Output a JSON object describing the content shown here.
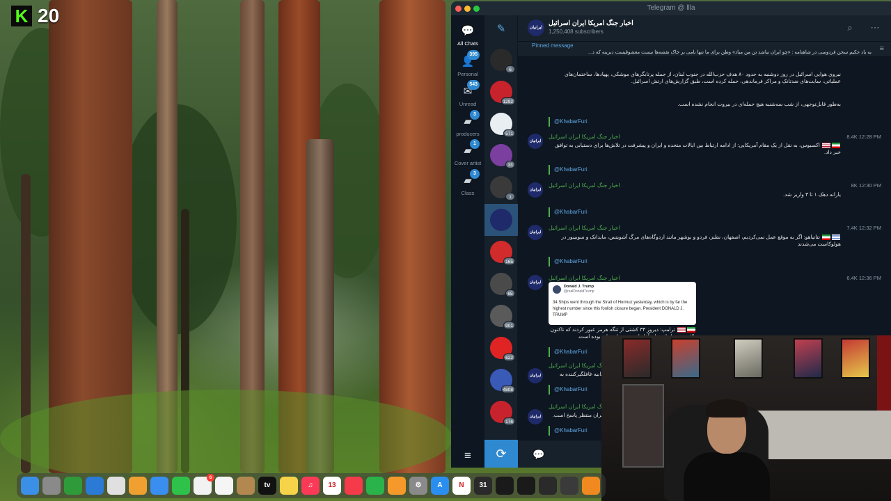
{
  "stream_badge": {
    "value": "20"
  },
  "window": {
    "title": "Telegram @ llla"
  },
  "folders": [
    {
      "label": "All Chats",
      "icon": "chats-icon",
      "badge": ""
    },
    {
      "label": "Personal",
      "icon": "personal-icon",
      "badge": "395"
    },
    {
      "label": "Unread",
      "icon": "unread-icon",
      "badge": "543"
    },
    {
      "label": "producers",
      "icon": "folder-icon",
      "badge": "3"
    },
    {
      "label": "Cover artist",
      "icon": "folder-icon",
      "badge": "1"
    },
    {
      "label": "Class",
      "icon": "folder-icon",
      "badge": "3"
    }
  ],
  "chats": [
    {
      "name": "chat-1",
      "badge": "6",
      "color": "#2a2a2a"
    },
    {
      "name": "chat-2",
      "badge": "1292",
      "color": "#c8232c"
    },
    {
      "name": "chat-3",
      "badge": "571",
      "color": "#e9eef2"
    },
    {
      "name": "chat-4",
      "badge": "33",
      "color": "#7b3fa0"
    },
    {
      "name": "chat-5",
      "badge": "1",
      "color": "#3a3a3a"
    },
    {
      "name": "chat-6",
      "badge": "",
      "color": "#1f2a6a"
    },
    {
      "name": "chat-7",
      "badge": "165",
      "color": "#d12b2b"
    },
    {
      "name": "chat-8",
      "badge": "65",
      "color": "#4a4a4a"
    },
    {
      "name": "chat-9",
      "badge": "901",
      "color": "#5a5a5a"
    },
    {
      "name": "chat-10",
      "badge": "622",
      "color": "#e02424"
    },
    {
      "name": "chat-11",
      "badge": "4808",
      "color": "#3a5ab8"
    },
    {
      "name": "chat-12",
      "badge": "176",
      "color": "#c8232c"
    }
  ],
  "channel": {
    "name": "اخبار جنگ امریکا ایران اسرائیل",
    "subscribers": "1,250,408 subscribers",
    "avatar_text": "ایرانیان"
  },
  "pinned": {
    "label": "Pinned message",
    "text": "به یاد حکیم سخن فردوسی در شاهنامه : «چو ایران نباشد تن من مباد» وطن برای ما تنها نامی بر خاک نقشه‌ها نیست معشوقیست دیرینه که د..."
  },
  "messages": [
    {
      "sender": "",
      "text": "نیروی هوایی اسرائیل در روز دوشنبه به حدود ۸۰ هدف حزب‌الله در جنوب لبنان، از جمله پرتابگرهای موشکی، پهپادها، ساختمان‌های عملیاتی، سایت‌های ضدتانک و مراکز فرماندهی، حمله کرده است، طبق گزارش‌های ارتش اسرائیل.",
      "meta": "",
      "extra": "به‌طور قابل‌توجهی، از شب سه‌شنبه هیچ حمله‌ای در بیروت انجام نشده است.",
      "forward": "@KhabarFuri"
    },
    {
      "sender": "اخبار جنگ امریکا ایران اسرائیل",
      "text": "اکسیوس، به نقل از یک مقام آمریکایی: از ادامه ارتباط بین ایالات متحده و ایران و پیشرفت در تلاش‌ها برای دستیابی به توافق خبر داد.",
      "meta": "8.4K 12:28 PM",
      "forward": "@KhabarFuri"
    },
    {
      "sender": "اخبار جنگ امریکا ایران اسرائیل",
      "text": "یارانه دهک ۱ تا ۳ واریز شد.",
      "meta": "8K 12:30 PM",
      "forward": "@KhabarFuri"
    },
    {
      "sender": "اخبار جنگ امریکا ایران اسرائیل",
      "text": "نتانیاهو: اگر به موقع عمل نمی‌کردیم، اصفهان، نطنز، فردو و بوشهر مانند اردوگاه‌های مرگ آشویتس، مایدانک و سوبیبور در هولوکاست می‌شدند",
      "meta": "7.4K 12:32 PM",
      "forward": "@KhabarFuri"
    },
    {
      "sender": "اخبار جنگ امریکا ایران اسرائیل",
      "text": "ترامپ: دیروز ۳۴ کشتی از تنگه هرمز عبور کردند که تاکنون بالاترین تعداد از زمان آغاز این بستن احمقانه بوده است.",
      "meta": "6.4K 12:36 PM",
      "forward": "@KhabarFuri",
      "tweet": {
        "name": "Donald J. Trump",
        "handle": "@realDonaldTrump",
        "body": "34 Ships went through the Strait of Hormuz yesterday, which is by far the highest number since this foolish closure began. President DONALD J. TRUMP"
      }
    },
    {
      "sender": "اخبار جنگ امریکا ایران اسرائیل",
      "text": "بیانیه غافلگیرکننده به",
      "meta": "",
      "forward": "@KhabarFuri"
    },
    {
      "sender": "اخبار جنگ امریکا ایران اسرائیل",
      "text": "ایران منتظر پاسخ است.",
      "meta": "",
      "forward": "@KhabarFuri"
    }
  ],
  "dock": [
    {
      "name": "finder-icon",
      "color": "#3b8fe6",
      "label": ""
    },
    {
      "name": "launchpad-icon",
      "color": "#8a8a8a",
      "label": ""
    },
    {
      "name": "app-green-icon",
      "color": "#2e9a3a",
      "label": ""
    },
    {
      "name": "safari-icon",
      "color": "#2a7ad6",
      "label": ""
    },
    {
      "name": "chrome-icon",
      "color": "#e0e0e0",
      "label": ""
    },
    {
      "name": "photos-icon",
      "color": "#f0a030",
      "label": ""
    },
    {
      "name": "mail-icon",
      "color": "#3a8ef0",
      "label": ""
    },
    {
      "name": "facetime-icon",
      "color": "#2ec24a",
      "label": ""
    },
    {
      "name": "app-badge-icon",
      "color": "#f2f2f2",
      "label": "",
      "badge": "6"
    },
    {
      "name": "freeform-icon",
      "color": "#f5f5f5",
      "label": ""
    },
    {
      "name": "app-brown-icon",
      "color": "#b38850",
      "label": ""
    },
    {
      "name": "appletv-icon",
      "color": "#111111",
      "label": "tv"
    },
    {
      "name": "notes-icon",
      "color": "#f7d34a",
      "label": ""
    },
    {
      "name": "music-icon",
      "color": "#fa3a56",
      "label": "♫"
    },
    {
      "name": "calendar-icon",
      "color": "#ffffff",
      "label": "13"
    },
    {
      "name": "news-icon",
      "color": "#f53a4a",
      "label": ""
    },
    {
      "name": "numbers-icon",
      "color": "#2ab34a",
      "label": ""
    },
    {
      "name": "pages-icon",
      "color": "#f59a2a",
      "label": ""
    },
    {
      "name": "settings-icon",
      "color": "#8a8a8a",
      "label": "⚙"
    },
    {
      "name": "appstore-icon",
      "color": "#2a8ef0",
      "label": "A"
    },
    {
      "name": "notion-icon",
      "color": "#ffffff",
      "label": "N"
    },
    {
      "name": "calendar2-icon",
      "color": "#2a2a2a",
      "label": "31"
    },
    {
      "name": "app-dark1-icon",
      "color": "#1a1a1a",
      "label": ""
    },
    {
      "name": "app-dark2-icon",
      "color": "#1a1a1a",
      "label": ""
    },
    {
      "name": "app-hex-icon",
      "color": "#2a2a2a",
      "label": ""
    },
    {
      "name": "app-gear-icon",
      "color": "#3a3a3a",
      "label": ""
    },
    {
      "name": "app-orange-icon",
      "color": "#f08a20",
      "label": ""
    }
  ]
}
